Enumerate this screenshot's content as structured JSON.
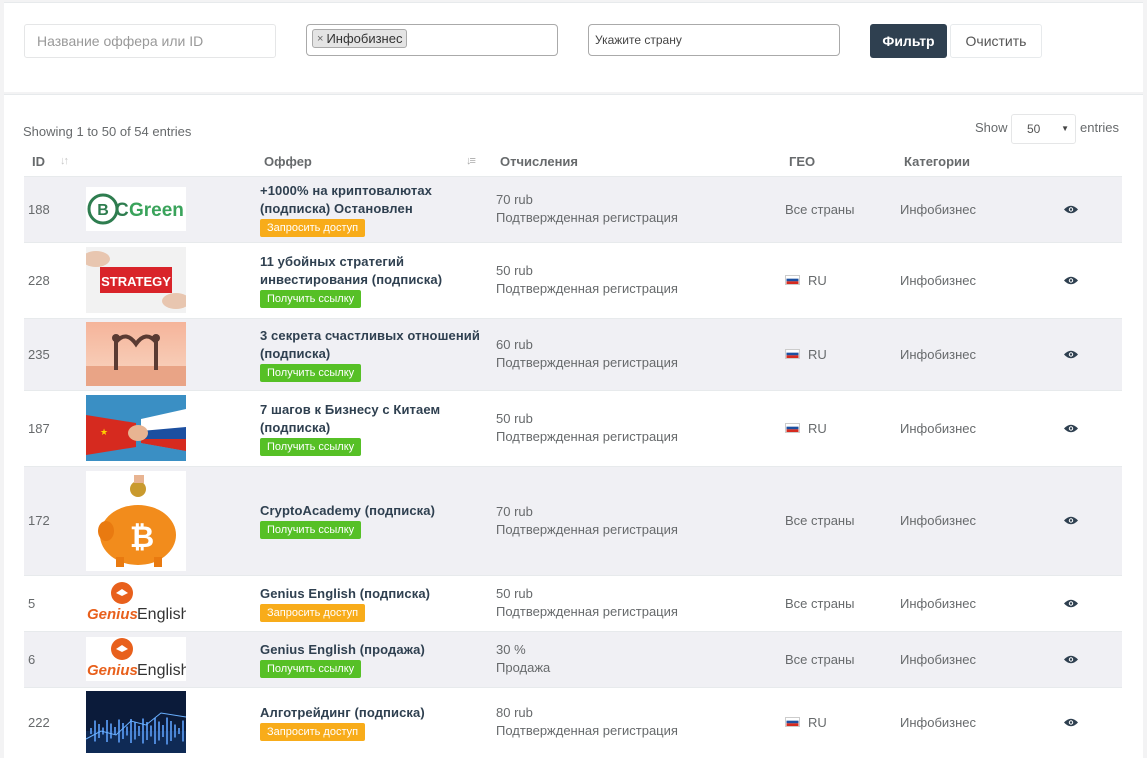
{
  "filters": {
    "offer_placeholder": "Название оффера или ID",
    "category_tag": "Инфобизнес",
    "tag_remove": "×",
    "country_placeholder": "Укажите страну",
    "filter_button": "Фильтр",
    "clear_button": "Очистить"
  },
  "table_info": "Showing 1 to 50 of 54 entries",
  "page_length": {
    "show_label": "Show",
    "value": "50",
    "entries_label": "entries"
  },
  "columns": {
    "id": "ID",
    "offer": "Оффер",
    "payout": "Отчисления",
    "geo": "ГЕО",
    "categories": "Категории"
  },
  "colors": {
    "orange_badge": "#f8ac1a",
    "green_badge": "#56c026",
    "filter_button": "#2f4050",
    "row_stripe": "#f0f0f4"
  },
  "rows": [
    {
      "id": "188",
      "thumb": "bcgreen-logo",
      "title": "+1000% на криптовалютах (подписка) Остановлен",
      "action": "Запросить доступ",
      "action_type": "orange",
      "payout": "70 rub",
      "payout_type": "Подтвержденная регистрация",
      "geo": "Все страны",
      "geo_flag": false,
      "category": "Инфобизнес",
      "thumb_text": "Green"
    },
    {
      "id": "228",
      "thumb": "strategy-puzzle",
      "title": "11 убойных стратегий инвестирования (подписка)",
      "action": "Получить ссылку",
      "action_type": "green",
      "payout": "50 rub",
      "payout_type": "Подтвержденная регистрация",
      "geo": "RU",
      "geo_flag": true,
      "category": "Инфобизнес",
      "thumb_text": "STRATEGY"
    },
    {
      "id": "235",
      "thumb": "couple-heart",
      "title": "3 секрета счастливых отношений (подписка)",
      "action": "Получить ссылку",
      "action_type": "green",
      "payout": "60 rub",
      "payout_type": "Подтвержденная регистрация",
      "geo": "RU",
      "geo_flag": true,
      "category": "Инфобизнес"
    },
    {
      "id": "187",
      "thumb": "handshake-china-russia",
      "title": "7 шагов к Бизнесу с Китаем (подписка)",
      "action": "Получить ссылку",
      "action_type": "green",
      "payout": "50 rub",
      "payout_type": "Подтвержденная регистрация",
      "geo": "RU",
      "geo_flag": true,
      "category": "Инфобизнес"
    },
    {
      "id": "172",
      "thumb": "bitcoin-piggy-bank",
      "title": "CryptoAcademy (подписка)",
      "action": "Получить ссылку",
      "action_type": "green",
      "payout": "70 rub",
      "payout_type": "Подтвержденная регистрация",
      "geo": "Все страны",
      "geo_flag": false,
      "category": "Инфобизнес"
    },
    {
      "id": "5",
      "thumb": "genius-english-logo",
      "title": "Genius English (подписка)",
      "action": "Запросить доступ",
      "action_type": "orange",
      "payout": "50 rub",
      "payout_type": "Подтвержденная регистрация",
      "geo": "Все страны",
      "geo_flag": false,
      "category": "Инфобизнес",
      "thumb_text": "Genius English"
    },
    {
      "id": "6",
      "thumb": "genius-english-logo",
      "title": "Genius English (продажа)",
      "action": "Получить ссылку",
      "action_type": "green",
      "payout": "30 %",
      "payout_type": "Продажа",
      "geo": "Все страны",
      "geo_flag": false,
      "category": "Инфобизнес",
      "thumb_text": "Genius English"
    },
    {
      "id": "222",
      "thumb": "algotrading-chart",
      "title": "Алготрейдинг (подписка)",
      "action": "Запросить доступ",
      "action_type": "orange",
      "payout": "80 rub",
      "payout_type": "Подтвержденная регистрация",
      "geo": "RU",
      "geo_flag": true,
      "category": "Инфобизнес"
    }
  ]
}
